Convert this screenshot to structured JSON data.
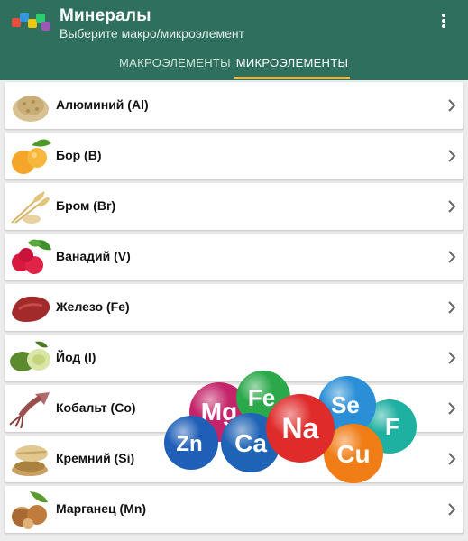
{
  "app": {
    "title": "Минералы",
    "subtitle": "Выберите макро/микроэлемент"
  },
  "tabs": [
    {
      "label": "МАКРОЭЛЕМЕНТЫ",
      "selected": false
    },
    {
      "label": "МИКРОЭЛЕМЕНТЫ",
      "selected": true
    }
  ],
  "colors": {
    "appbar": "#2f6f5e",
    "tab_indicator": "#e9b53c"
  },
  "elements": [
    {
      "label": "Алюминий (Al)",
      "icon": "oat-grain-icon"
    },
    {
      "label": "Бор (B)",
      "icon": "apricot-icon"
    },
    {
      "label": "Бром (Br)",
      "icon": "wheat-icon"
    },
    {
      "label": "Ванадий (V)",
      "icon": "radish-icon"
    },
    {
      "label": "Железо (Fe)",
      "icon": "liver-meat-icon"
    },
    {
      "label": "Йод (I)",
      "icon": "feijoa-icon"
    },
    {
      "label": "Кобальт (Co)",
      "icon": "squid-icon"
    },
    {
      "label": "Кремний (Si)",
      "icon": "bran-grain-icon"
    },
    {
      "label": "Марганец (Mn)",
      "icon": "hazelnut-icon"
    }
  ],
  "balls": [
    {
      "symbol": "Mg",
      "color": "#c4256a"
    },
    {
      "symbol": "Fe",
      "color": "#2aa84a"
    },
    {
      "symbol": "Se",
      "color": "#2a8fd6"
    },
    {
      "symbol": "F",
      "color": "#1eb0a0"
    },
    {
      "symbol": "Zn",
      "color": "#1f5fb8"
    },
    {
      "symbol": "Ca",
      "color": "#1e63b5"
    },
    {
      "symbol": "Na",
      "color": "#e02b2b"
    },
    {
      "symbol": "Cu",
      "color": "#f07d16"
    }
  ]
}
